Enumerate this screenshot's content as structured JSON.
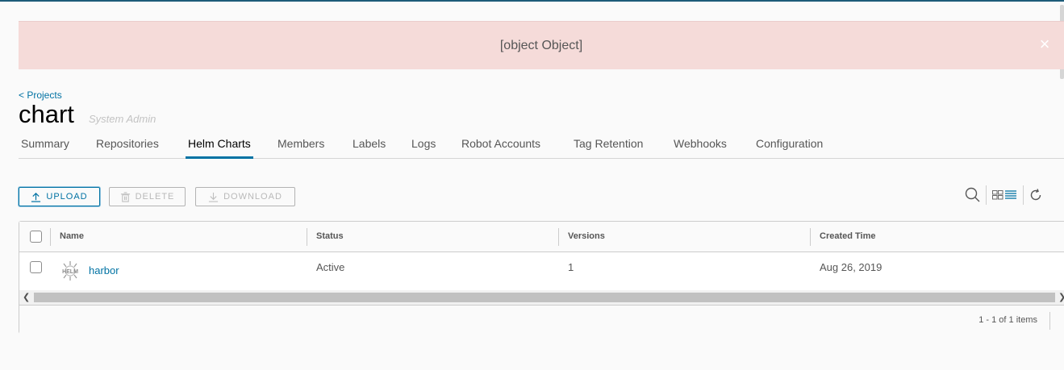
{
  "alert": {
    "message": "[object Object]",
    "close_label": "×"
  },
  "breadcrumb": "< Projects",
  "project": {
    "name": "chart",
    "role": "System Admin"
  },
  "tabs": [
    {
      "label": "Summary"
    },
    {
      "label": "Repositories"
    },
    {
      "label": "Helm Charts"
    },
    {
      "label": "Members"
    },
    {
      "label": "Labels"
    },
    {
      "label": "Logs"
    },
    {
      "label": "Robot Accounts"
    },
    {
      "label": "Tag Retention"
    },
    {
      "label": "Webhooks"
    },
    {
      "label": "Configuration"
    }
  ],
  "active_tab": "Helm Charts",
  "toolbar": {
    "upload": "UPLOAD",
    "delete": "DELETE",
    "download": "DOWNLOAD"
  },
  "icons": {
    "search": "search-icon",
    "card_view": "card-view-icon",
    "list_view": "list-view-icon",
    "refresh": "refresh-icon",
    "helm": "helm-icon"
  },
  "table": {
    "columns": [
      "Name",
      "Status",
      "Versions",
      "Created Time"
    ],
    "rows": [
      {
        "name": "harbor",
        "status": "Active",
        "versions": "1",
        "created": "Aug 26, 2019",
        "icon_text": "HELM"
      }
    ],
    "pagination": "1 - 1 of 1 items"
  },
  "colors": {
    "accent": "#0072a3",
    "alert_bg": "#f5dbd9",
    "header_bar": "#1d5b79"
  }
}
